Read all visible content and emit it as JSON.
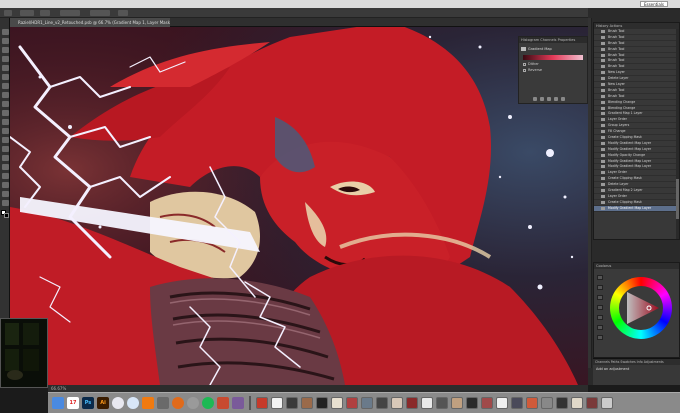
{
  "app": {
    "workspace": "Essentials"
  },
  "document": {
    "tab_title": "Raziel/HDR1_Line_v2_Retouched.psb @ 66.7% (Gradient Map 1, Layer Mask/8)"
  },
  "status": {
    "zoom": "66.67%"
  },
  "panels": {
    "properties": {
      "tabs": "Histogram  Channels  Properties",
      "title": "Gradient Map",
      "option1": "Dither",
      "option2": "Reverse"
    },
    "history": {
      "tabs": "History  Actions",
      "items": [
        "Brush Tool",
        "Brush Tool",
        "Brush Tool",
        "Brush Tool",
        "Brush Tool",
        "Brush Tool",
        "Brush Tool",
        "New Layer",
        "Delete Layer",
        "New Layer",
        "Brush Tool",
        "Brush Tool",
        "Blending Change",
        "Blending Change",
        "Gradient Map 1 Layer",
        "Layer Order",
        "Group Layers",
        "Fill Change",
        "Create Clipping Mask",
        "Modify Gradient Map Layer",
        "Modify Gradient Map Layer",
        "Modify Opacity Change",
        "Modify Gradient Map Layer",
        "Modify Gradient Map Layer",
        "Layer Order",
        "Create Clipping Mask",
        "Delete Layer",
        "Gradient Map 2 Layer",
        "Layer Order",
        "Create Clipping Mask",
        "Modify Gradient Map Layer"
      ],
      "selected_index": 30
    },
    "color": {
      "tabs": "Coolorus"
    },
    "adjustments": {
      "tabs": "Channels  Paths  Swatches  Info  Adjustments",
      "hint": "Add an adjustment"
    }
  },
  "colors": {
    "accent_selection": "#5d6f8c",
    "hair_red": "#c81e28",
    "skin": "#e8cfa8"
  },
  "dock": {
    "icons": [
      "finder-icon",
      "calendar-icon",
      "photoshop-icon",
      "illustrator-icon",
      "itunes-icon",
      "safari-icon",
      "vlc-icon",
      "tool-icon",
      "firefox-icon",
      "settings-icon",
      "spotify-icon",
      "app-icon",
      "trash-icon"
    ],
    "labels": {
      "calendar": "17",
      "photoshop": "Ps",
      "illustrator": "Ai"
    }
  }
}
